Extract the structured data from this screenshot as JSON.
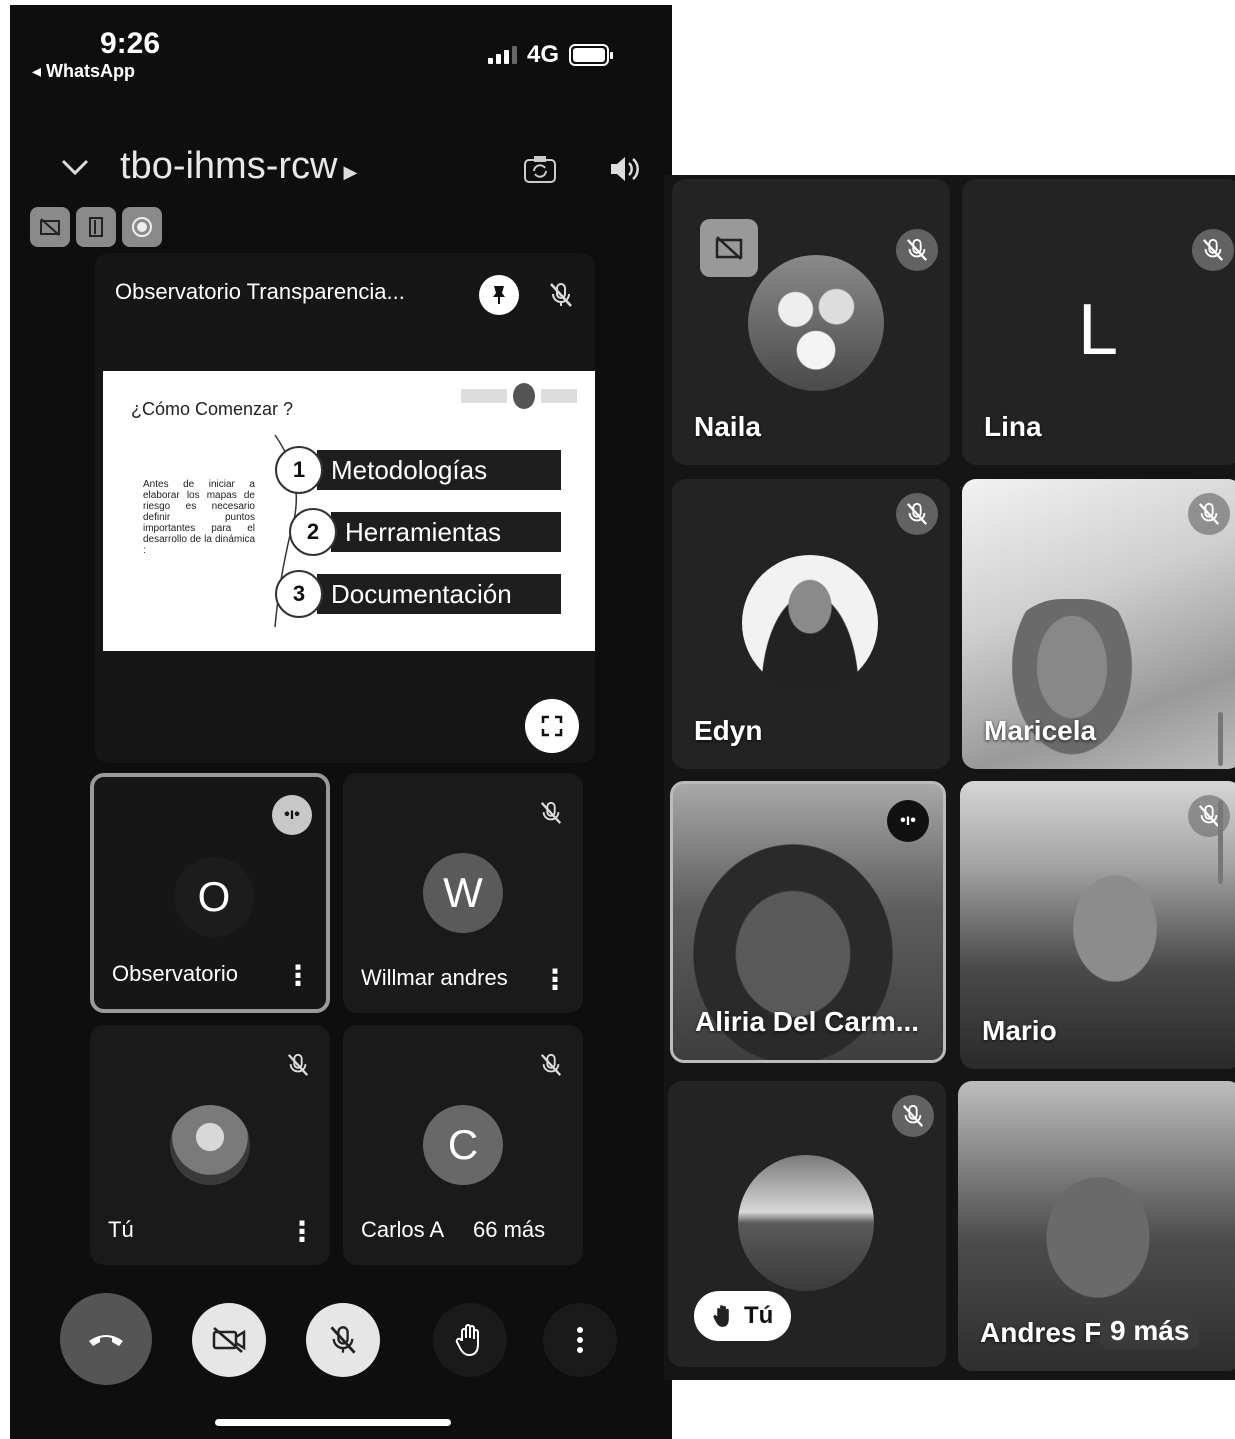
{
  "status": {
    "time": "9:26",
    "back_app": "◂ WhatsApp",
    "network": "4G"
  },
  "meeting": {
    "code": "tbo-ihms-rcw",
    "presenter_title": "Observatorio Transparencia..."
  },
  "slide": {
    "title": "¿Cómo Comenzar ?",
    "description": "Antes de iniciar a elaborar los mapas de riesgo es necesario definir puntos importantes para el desarrollo de la dinámica :",
    "items": [
      {
        "num": "1",
        "label": "Metodologías"
      },
      {
        "num": "2",
        "label": "Herramientas"
      },
      {
        "num": "3",
        "label": "Documentación"
      }
    ]
  },
  "phone_tiles": [
    {
      "initial": "O",
      "name": "Observatorio",
      "color": "#1c1c1c"
    },
    {
      "initial": "W",
      "name": "Willmar andres",
      "color": "#5a5a5a"
    },
    {
      "initial": "",
      "name": "Tú",
      "color": "#888888"
    },
    {
      "initial": "C",
      "name": "Carlos A",
      "color": "#686868",
      "more": "66 más"
    }
  ],
  "grid_tiles": [
    {
      "name": "Naila"
    },
    {
      "name": "Lina",
      "initial": "L"
    },
    {
      "name": "Edyn"
    },
    {
      "name": "Maricela"
    },
    {
      "name": "Aliria Del Carm..."
    },
    {
      "name": "Mario"
    },
    {
      "name": "Tú"
    },
    {
      "name": "Andres F",
      "more": "9 más"
    }
  ],
  "colors": {
    "panel_bg": "#0e0e0e",
    "tile_bg": "#1a1a1a",
    "end_call": "#555555"
  }
}
